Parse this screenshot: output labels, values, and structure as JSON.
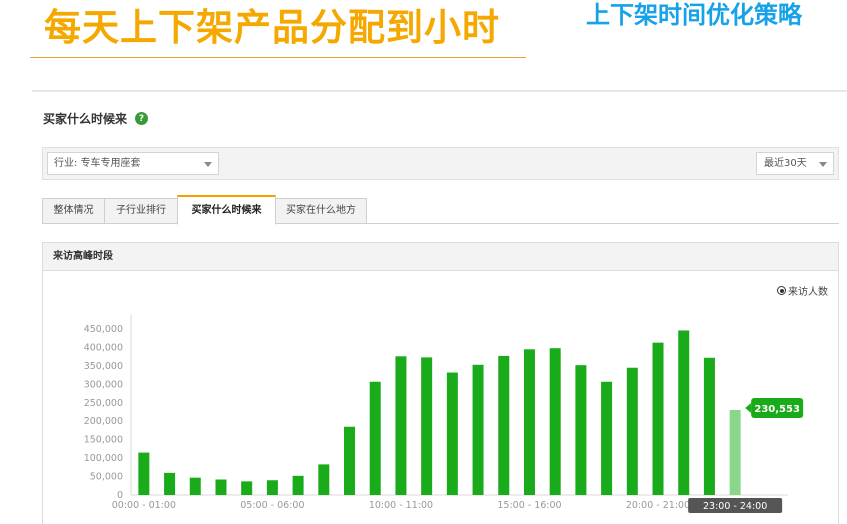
{
  "slide": {
    "title": "每天上下架产品分配到小时",
    "subtitle": "上下架时间优化策略"
  },
  "section": {
    "heading": "买家什么时候来",
    "help_icon": "question-circle-icon"
  },
  "filters": {
    "industry": "行业: 专车专用座套",
    "range": "最近30天"
  },
  "tabs": [
    {
      "label": "整体情况",
      "active": false
    },
    {
      "label": "子行业排行",
      "active": false
    },
    {
      "label": "买家什么时候来",
      "active": true
    },
    {
      "label": "买家在什么地方",
      "active": false
    }
  ],
  "panel": {
    "title": "来访高峰时段"
  },
  "legend": {
    "label": "来访人数"
  },
  "tooltip": {
    "value": "230,553",
    "hover_hour": "23:00 - 24:00"
  },
  "colors": {
    "bar": "#1aab1a",
    "bar_highlight": "#8ad68a",
    "tooltip_bg": "#1aab1a",
    "title_orange": "#f5a800",
    "subtitle_blue": "#16a2e8"
  },
  "chart_data": {
    "type": "bar",
    "title": "来访高峰时段",
    "series": [
      {
        "name": "来访人数",
        "values": [
          115000,
          60000,
          47000,
          42000,
          37000,
          40000,
          52000,
          83000,
          185000,
          307000,
          376000,
          373000,
          332000,
          353000,
          377000,
          395000,
          398000,
          352000,
          307000,
          345000,
          413000,
          446000,
          372000,
          230553
        ]
      }
    ],
    "categories": [
      "00:00 - 01:00",
      "01:00 - 02:00",
      "02:00 - 03:00",
      "03:00 - 04:00",
      "04:00 - 05:00",
      "05:00 - 06:00",
      "06:00 - 07:00",
      "07:00 - 08:00",
      "08:00 - 09:00",
      "09:00 - 10:00",
      "10:00 - 11:00",
      "11:00 - 12:00",
      "12:00 - 13:00",
      "13:00 - 14:00",
      "14:00 - 15:00",
      "15:00 - 16:00",
      "16:00 - 17:00",
      "17:00 - 18:00",
      "18:00 - 19:00",
      "19:00 - 20:00",
      "20:00 - 21:00",
      "21:00 - 22:00",
      "22:00 - 23:00",
      "23:00 - 24:00"
    ],
    "x_tick_labels": [
      {
        "index": 0,
        "label": "00:00 - 01:00"
      },
      {
        "index": 5,
        "label": "05:00 - 06:00"
      },
      {
        "index": 10,
        "label": "10:00 - 11:00"
      },
      {
        "index": 15,
        "label": "15:00 - 16:00"
      },
      {
        "index": 20,
        "label": "20:00 - 21:00"
      }
    ],
    "y_ticks": [
      "0",
      "50,000",
      "100,000",
      "150,000",
      "200,000",
      "250,000",
      "300,000",
      "350,000",
      "400,000",
      "450,000"
    ],
    "ylim": [
      0,
      450000
    ],
    "highlight_index": 23,
    "grid": false
  }
}
